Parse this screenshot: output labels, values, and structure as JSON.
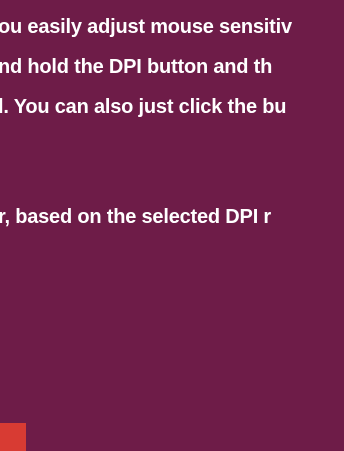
{
  "content": {
    "lines": [
      "ou easily adjust mouse sensitiv",
      "nd hold the DPI button and th",
      "l. You can also just click the bu",
      "r, based on the selected DPI r"
    ]
  },
  "colors": {
    "background": "#6e1c48",
    "text": "#ffffff",
    "accent": "#d83b33"
  }
}
